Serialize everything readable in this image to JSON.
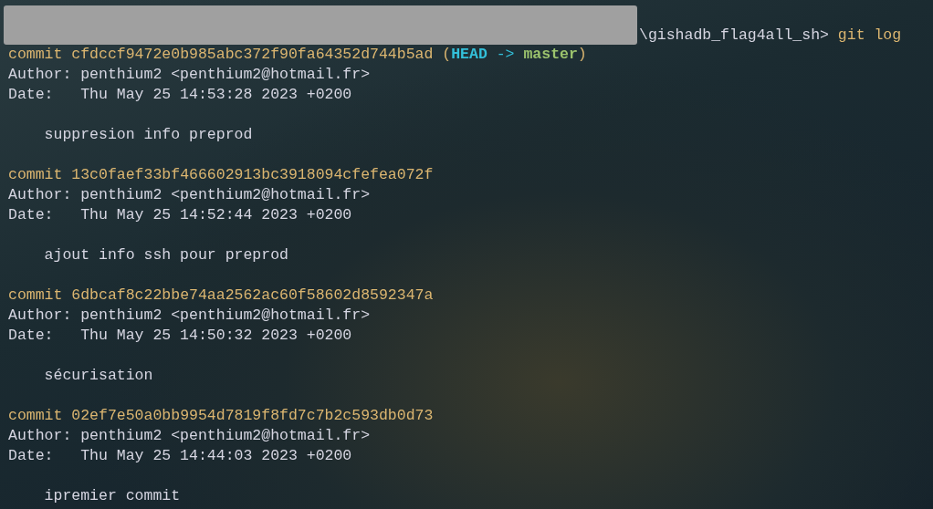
{
  "prompt": {
    "path": "\\gishadb_flag4all_sh>",
    "command": "git log"
  },
  "commits": [
    {
      "commit_label": "commit",
      "hash": "cfdccf9472e0b985abc372f90fa64352d744b5ad",
      "refs": {
        "open": "(",
        "head": "HEAD",
        "arrow": "->",
        "branch": "master",
        "close": ")"
      },
      "author_label": "Author:",
      "author": "penthium2 <penthium2@hotmail.fr>",
      "date_label": "Date:",
      "date": "Thu May 25 14:53:28 2023 +0200",
      "message": "suppresion info preprod"
    },
    {
      "commit_label": "commit",
      "hash": "13c0faef33bf466602913bc3918094cfefea072f",
      "author_label": "Author:",
      "author": "penthium2 <penthium2@hotmail.fr>",
      "date_label": "Date:",
      "date": "Thu May 25 14:52:44 2023 +0200",
      "message": "ajout info ssh pour preprod"
    },
    {
      "commit_label": "commit",
      "hash": "6dbcaf8c22bbe74aa2562ac60f58602d8592347a",
      "author_label": "Author:",
      "author": "penthium2 <penthium2@hotmail.fr>",
      "date_label": "Date:",
      "date": "Thu May 25 14:50:32 2023 +0200",
      "message": "sécurisation"
    },
    {
      "commit_label": "commit",
      "hash": "02ef7e50a0bb9954d7819f8fd7c7b2c593db0d73",
      "author_label": "Author:",
      "author": "penthium2 <penthium2@hotmail.fr>",
      "date_label": "Date:",
      "date": "Thu May 25 14:44:03 2023 +0200",
      "message": "ipremier commit"
    }
  ]
}
